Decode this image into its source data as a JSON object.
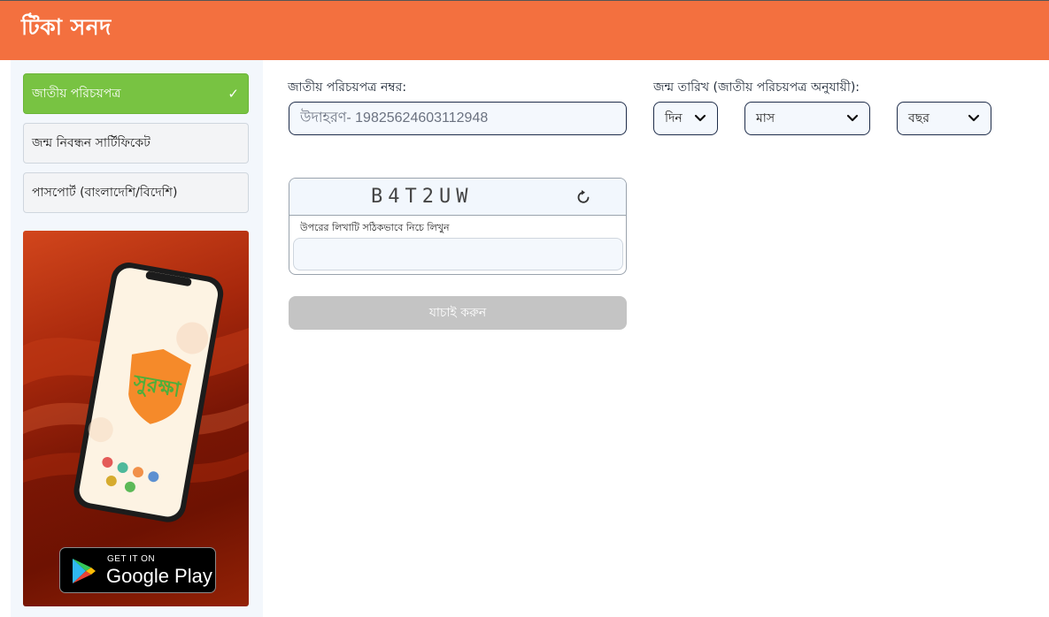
{
  "header": {
    "title": "টিকা সনদ"
  },
  "sidebar": {
    "items": [
      {
        "label": "জাতীয় পরিচয়পত্র",
        "active": true
      },
      {
        "label": "জন্ম নিবন্ধন সার্টিফিকেট",
        "active": false
      },
      {
        "label": "পাসপোর্ট (বাংলাদেশি/বিদেশি)",
        "active": false
      }
    ],
    "promo": {
      "app_name": "সুরক্ষা",
      "store_badge_top": "GET IT ON",
      "store_badge_main": "Google Play"
    }
  },
  "form": {
    "nid_label": "জাতীয় পরিচয়পত্র নম্বর:",
    "nid_placeholder": "উদাহরণ- 19825624603112948",
    "dob_label": "জন্ম তারিখ (জাতীয় পরিচয়পত্র অনুযায়ী):",
    "day_placeholder": "দিন",
    "month_placeholder": "মাস",
    "year_placeholder": "বছর",
    "captcha_code": "B4T2UW",
    "captcha_hint": "উপরের লিখাটি সঠিকভাবে নিচে লিখুন",
    "verify_label": "যাচাই করুন"
  },
  "colors": {
    "header": "#f3703f",
    "active_tab": "#78c342",
    "disabled_button": "#c4c4c4"
  }
}
